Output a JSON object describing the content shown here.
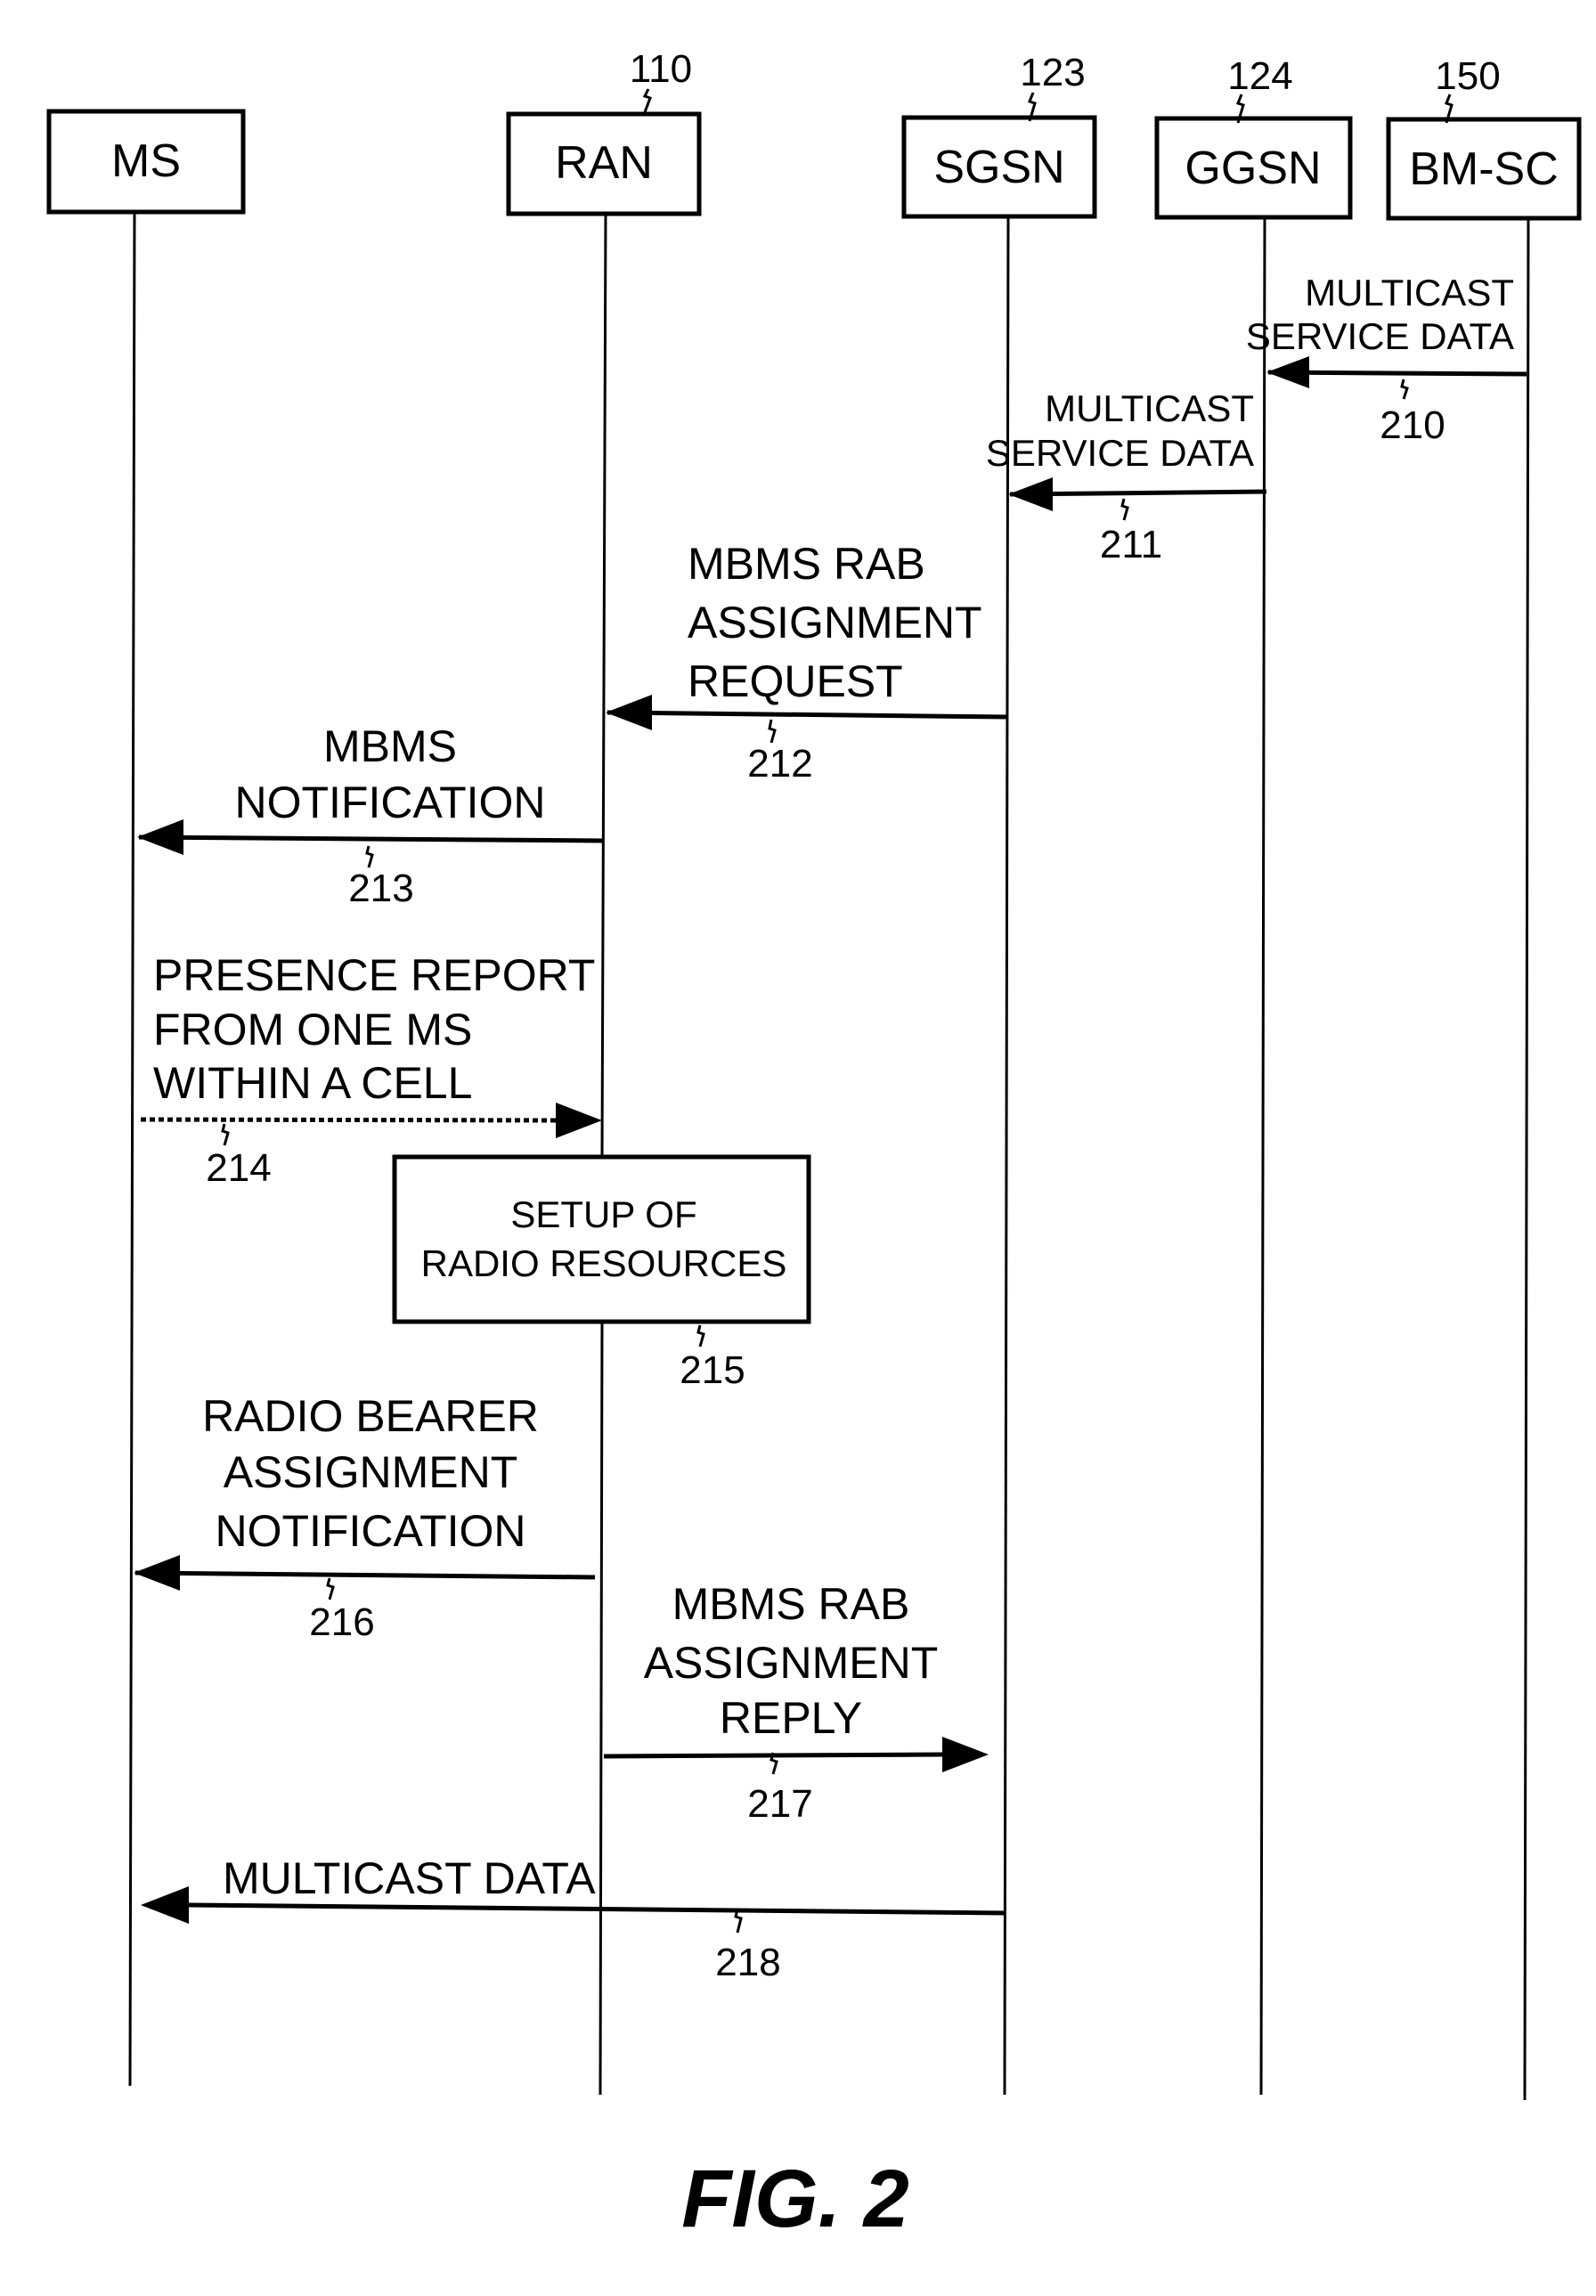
{
  "figure": {
    "caption": "FIG. 2"
  },
  "entities": [
    {
      "id": "ms",
      "label": "MS",
      "ref": ""
    },
    {
      "id": "ran",
      "label": "RAN",
      "ref": "110"
    },
    {
      "id": "sgsn",
      "label": "SGSN",
      "ref": "123"
    },
    {
      "id": "ggsn",
      "label": "GGSN",
      "ref": "124"
    },
    {
      "id": "bmsc",
      "label": "BM-SC",
      "ref": "150"
    }
  ],
  "messages": [
    {
      "ref": "210",
      "from": "bmsc",
      "to": "ggsn",
      "style": "solid",
      "lines": [
        "MULTICAST",
        "SERVICE DATA"
      ]
    },
    {
      "ref": "211",
      "from": "ggsn",
      "to": "sgsn",
      "style": "solid",
      "lines": [
        "MULTICAST",
        "SERVICE DATA"
      ]
    },
    {
      "ref": "212",
      "from": "sgsn",
      "to": "ran",
      "style": "solid",
      "lines": [
        "MBMS RAB",
        "ASSIGNMENT",
        "REQUEST"
      ]
    },
    {
      "ref": "213",
      "from": "ran",
      "to": "ms",
      "style": "solid",
      "lines": [
        "MBMS",
        "NOTIFICATION"
      ]
    },
    {
      "ref": "214",
      "from": "ms",
      "to": "ran",
      "style": "dashed",
      "lines": [
        "PRESENCE REPORT",
        "FROM ONE MS",
        "WITHIN A CELL"
      ]
    },
    {
      "ref": "216",
      "from": "ran",
      "to": "ms",
      "style": "solid",
      "lines": [
        "RADIO BEARER",
        "ASSIGNMENT",
        "NOTIFICATION"
      ]
    },
    {
      "ref": "217",
      "from": "ran",
      "to": "sgsn",
      "style": "solid",
      "lines": [
        "MBMS RAB",
        "ASSIGNMENT",
        "REPLY"
      ]
    },
    {
      "ref": "218",
      "from": "sgsn",
      "to": "ms",
      "style": "solid",
      "lines": [
        "MULTICAST DATA"
      ]
    }
  ],
  "process": {
    "ref": "215",
    "lines": [
      "SETUP OF",
      "RADIO RESOURCES"
    ]
  }
}
